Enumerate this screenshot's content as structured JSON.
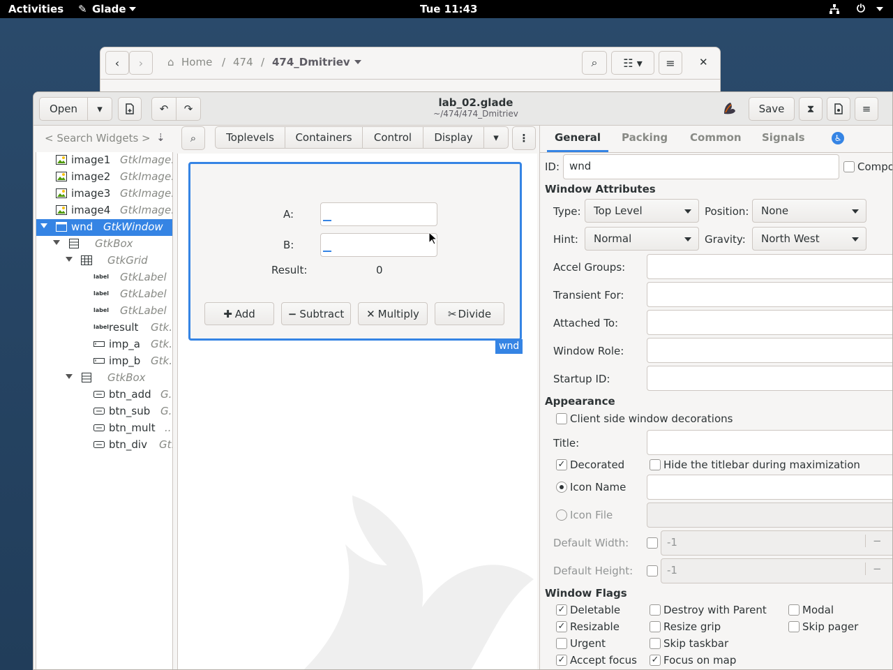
{
  "topbar": {
    "activities": "Activities",
    "app": "Glade",
    "clock": "Tue 11:43"
  },
  "filemanager": {
    "crumb_home": "Home",
    "crumb_1": "474",
    "crumb_2": "474_Dmitriev",
    "sep": "/"
  },
  "window": {
    "title": "lab_02.glade",
    "subtitle": "~/474/474_Dmitriev",
    "open_label": "Open",
    "save_label": "Save"
  },
  "search": {
    "placeholder": "< Search Widgets >"
  },
  "palette": {
    "tabs": [
      "Toplevels",
      "Containers",
      "Control",
      "Display"
    ]
  },
  "tree": [
    {
      "name": "image1",
      "type": "GtkImage."
    },
    {
      "name": "image2",
      "type": "GtkImage."
    },
    {
      "name": "image3",
      "type": "GtkImage."
    },
    {
      "name": "image4",
      "type": "GtkImage."
    },
    {
      "name": "wnd",
      "type": "GtkWindow"
    },
    {
      "name": "",
      "type": "GtkBox"
    },
    {
      "name": "",
      "type": "GtkGrid"
    },
    {
      "name": "",
      "type": "GtkLabel"
    },
    {
      "name": "",
      "type": "GtkLabel"
    },
    {
      "name": "",
      "type": "GtkLabel"
    },
    {
      "name": "result",
      "type": "Gtk."
    },
    {
      "name": "imp_a",
      "type": "Gtk."
    },
    {
      "name": "imp_b",
      "type": "Gtk."
    },
    {
      "name": "",
      "type": "GtkBox"
    },
    {
      "name": "btn_add",
      "type": "G."
    },
    {
      "name": "btn_sub",
      "type": "G."
    },
    {
      "name": "btn_mult",
      "type": ".."
    },
    {
      "name": "btn_div",
      "type": "Gt."
    }
  ],
  "design": {
    "label_a": "A:",
    "label_b": "B:",
    "label_result": "Result:",
    "result_value": "0",
    "btn_add": "Add",
    "btn_sub": "Subtract",
    "btn_mult": "Multiply",
    "btn_div": "Divide",
    "badge": "wnd"
  },
  "props": {
    "tabs": [
      "General",
      "Packing",
      "Common",
      "Signals"
    ],
    "id_label": "ID:",
    "id_value": "wnd",
    "composite": "Compo",
    "win_attrs": "Window Attributes",
    "type_label": "Type:",
    "type_value": "Top Level",
    "position_label": "Position:",
    "position_value": "None",
    "hint_label": "Hint:",
    "hint_value": "Normal",
    "gravity_label": "Gravity:",
    "gravity_value": "North West",
    "accel": "Accel Groups:",
    "transient": "Transient For:",
    "attached": "Attached To:",
    "role": "Window Role:",
    "startup": "Startup ID:",
    "appearance": "Appearance",
    "csd": "Client side window decorations",
    "title": "Title:",
    "decorated": "Decorated",
    "hide_titlebar": "Hide the titlebar during maximization",
    "icon_name": "Icon Name",
    "icon_file": "Icon File",
    "def_width": "Default Width:",
    "def_height": "Default Height:",
    "def_width_val": "-1",
    "def_height_val": "-1",
    "flags": "Window Flags",
    "deletable": "Deletable",
    "destroy_parent": "Destroy with Parent",
    "modal": "Modal",
    "resizable": "Resizable",
    "resize_grip": "Resize grip",
    "skip_pager": "Skip pager",
    "urgent": "Urgent",
    "skip_taskbar": "Skip taskbar",
    "accept_focus": "Accept focus",
    "focus_map": "Focus on map"
  },
  "colors": {
    "accent": "#3584e4"
  }
}
